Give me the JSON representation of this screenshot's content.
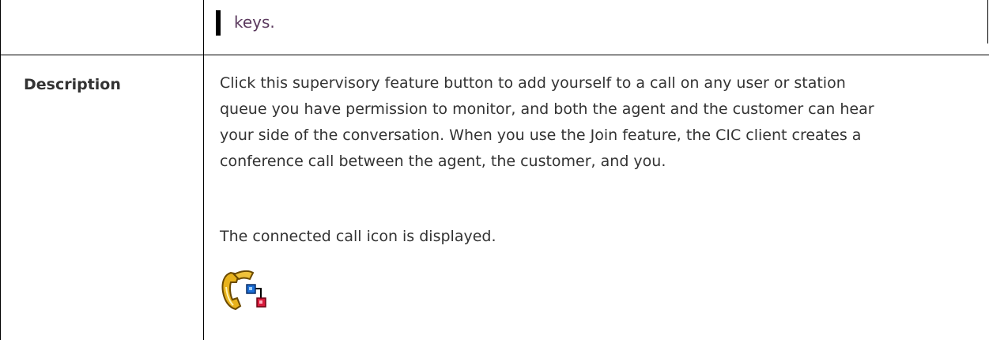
{
  "top_row": {
    "text": "keys."
  },
  "description_row": {
    "label": "Description",
    "paragraph1": "Click this supervisory feature button to add yourself to a call on any user or station queue you have permission to monitor, and both the agent and the customer can hear your side of the conversation. When you use the Join feature, the CIC client creates a conference call between the agent, the customer, and you.",
    "paragraph2": "The connected call icon is displayed.",
    "icon": "connected-call-icon"
  }
}
